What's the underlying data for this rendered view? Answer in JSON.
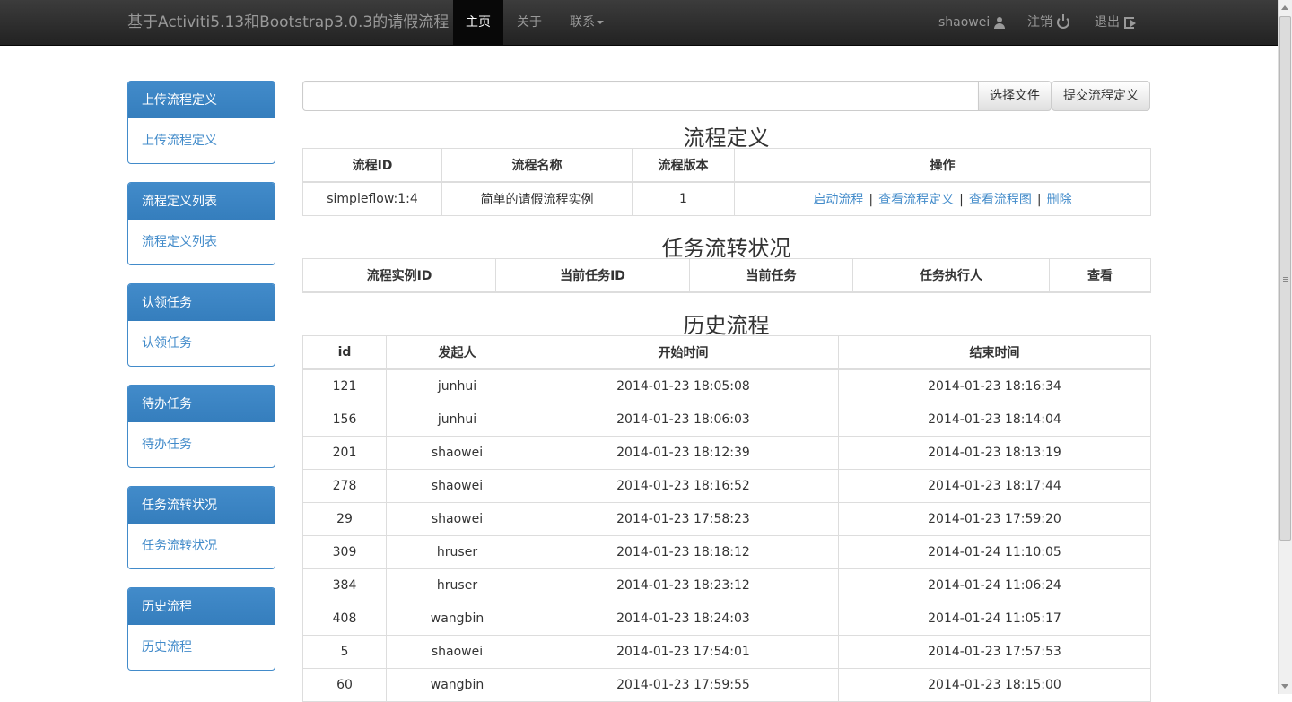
{
  "navbar": {
    "brand": "基于Activiti5.13和Bootstrap3.0.3的请假流程",
    "items": [
      {
        "label": "主页",
        "active": true
      },
      {
        "label": "关于"
      },
      {
        "label": "联系"
      }
    ],
    "user": "shaowei",
    "logout": "注销",
    "exit": "退出"
  },
  "sidebar": [
    {
      "heading": "上传流程定义",
      "link": "上传流程定义"
    },
    {
      "heading": "流程定义列表",
      "link": "流程定义列表"
    },
    {
      "heading": "认领任务",
      "link": "认领任务"
    },
    {
      "heading": "待办任务",
      "link": "待办任务"
    },
    {
      "heading": "任务流转状况",
      "link": "任务流转状况"
    },
    {
      "heading": "历史流程",
      "link": "历史流程"
    }
  ],
  "upload": {
    "file_value": "",
    "choose_label": "选择文件",
    "submit_label": "提交流程定义"
  },
  "definitions": {
    "title": "流程定义",
    "headers": [
      "流程ID",
      "流程名称",
      "流程版本",
      "操作"
    ],
    "rows": [
      {
        "id": "simpleflow:1:4",
        "name": "简单的请假流程实例",
        "version": "1",
        "actions": [
          "启动流程",
          "查看流程定义",
          "查看流程图",
          "删除"
        ]
      }
    ]
  },
  "tasks": {
    "title": "任务流转状况",
    "headers": [
      "流程实例ID",
      "当前任务ID",
      "当前任务",
      "任务执行人",
      "查看"
    ]
  },
  "history": {
    "title": "历史流程",
    "headers": [
      "id",
      "发起人",
      "开始时间",
      "结束时间"
    ],
    "rows": [
      [
        "121",
        "junhui",
        "2014-01-23 18:05:08",
        "2014-01-23 18:16:34"
      ],
      [
        "156",
        "junhui",
        "2014-01-23 18:06:03",
        "2014-01-23 18:14:04"
      ],
      [
        "201",
        "shaowei",
        "2014-01-23 18:12:39",
        "2014-01-23 18:13:19"
      ],
      [
        "278",
        "shaowei",
        "2014-01-23 18:16:52",
        "2014-01-23 18:17:44"
      ],
      [
        "29",
        "shaowei",
        "2014-01-23 17:58:23",
        "2014-01-23 17:59:20"
      ],
      [
        "309",
        "hruser",
        "2014-01-23 18:18:12",
        "2014-01-24 11:10:05"
      ],
      [
        "384",
        "hruser",
        "2014-01-23 18:23:12",
        "2014-01-24 11:06:24"
      ],
      [
        "408",
        "wangbin",
        "2014-01-23 18:24:03",
        "2014-01-24 11:05:17"
      ],
      [
        "5",
        "shaowei",
        "2014-01-23 17:54:01",
        "2014-01-23 17:57:53"
      ],
      [
        "60",
        "wangbin",
        "2014-01-23 17:59:55",
        "2014-01-23 18:15:00"
      ]
    ]
  }
}
